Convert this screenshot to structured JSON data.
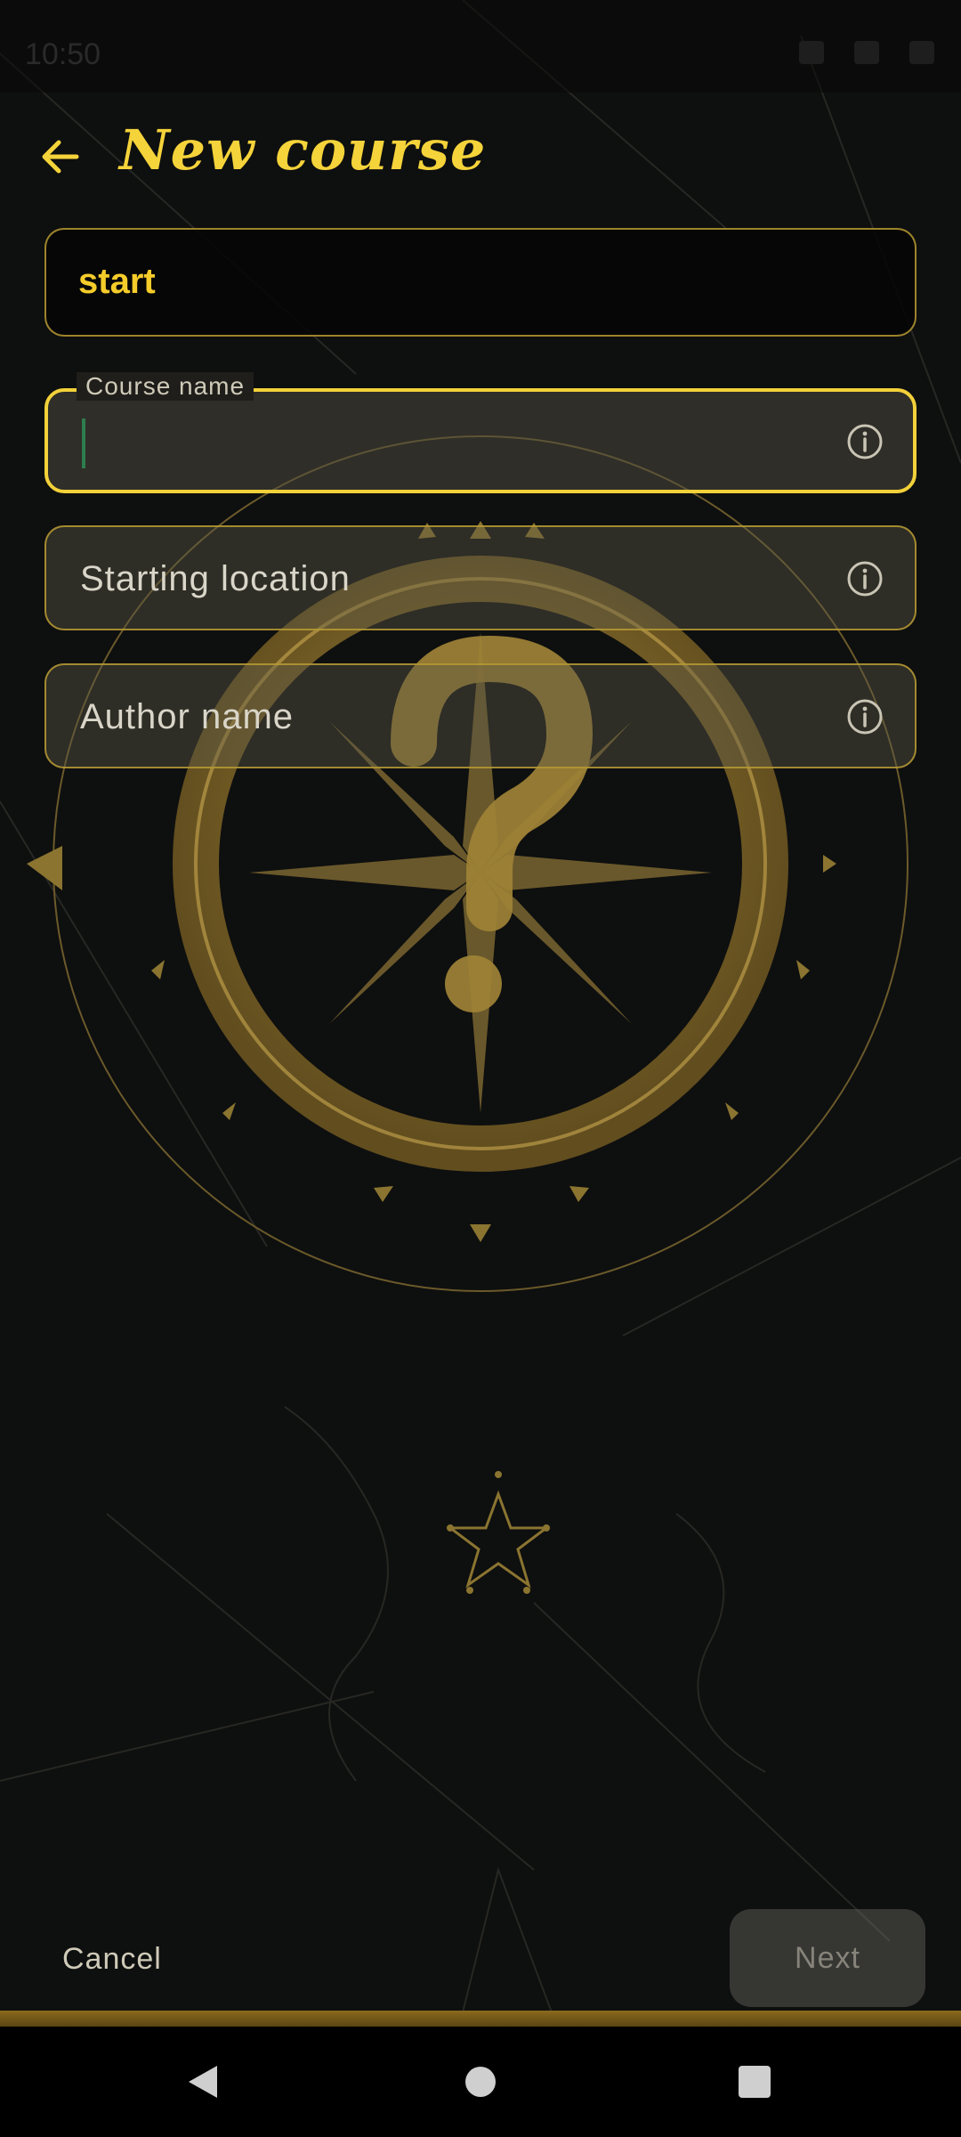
{
  "status_bar": {
    "time": "10:50"
  },
  "app_bar": {
    "title": "New course"
  },
  "form": {
    "start_field": {
      "value": "start"
    },
    "course_name": {
      "label": "Course name",
      "value": ""
    },
    "starting_location": {
      "placeholder": "Starting location"
    },
    "author_name": {
      "placeholder": "Author name"
    }
  },
  "actions": {
    "cancel_label": "Cancel",
    "next_label": "Next"
  },
  "colors": {
    "accent_yellow": "#f5d33a",
    "field_border": "#b99b32",
    "background": "#0e0f0f",
    "next_disabled_text": "#86837a"
  },
  "icons": {
    "back": "arrow-left-icon",
    "info": "info-circle-icon",
    "emblem": "compass-question-emblem",
    "nav_back": "triangle-back-icon",
    "nav_home": "circle-home-icon",
    "nav_recents": "square-recents-icon"
  }
}
